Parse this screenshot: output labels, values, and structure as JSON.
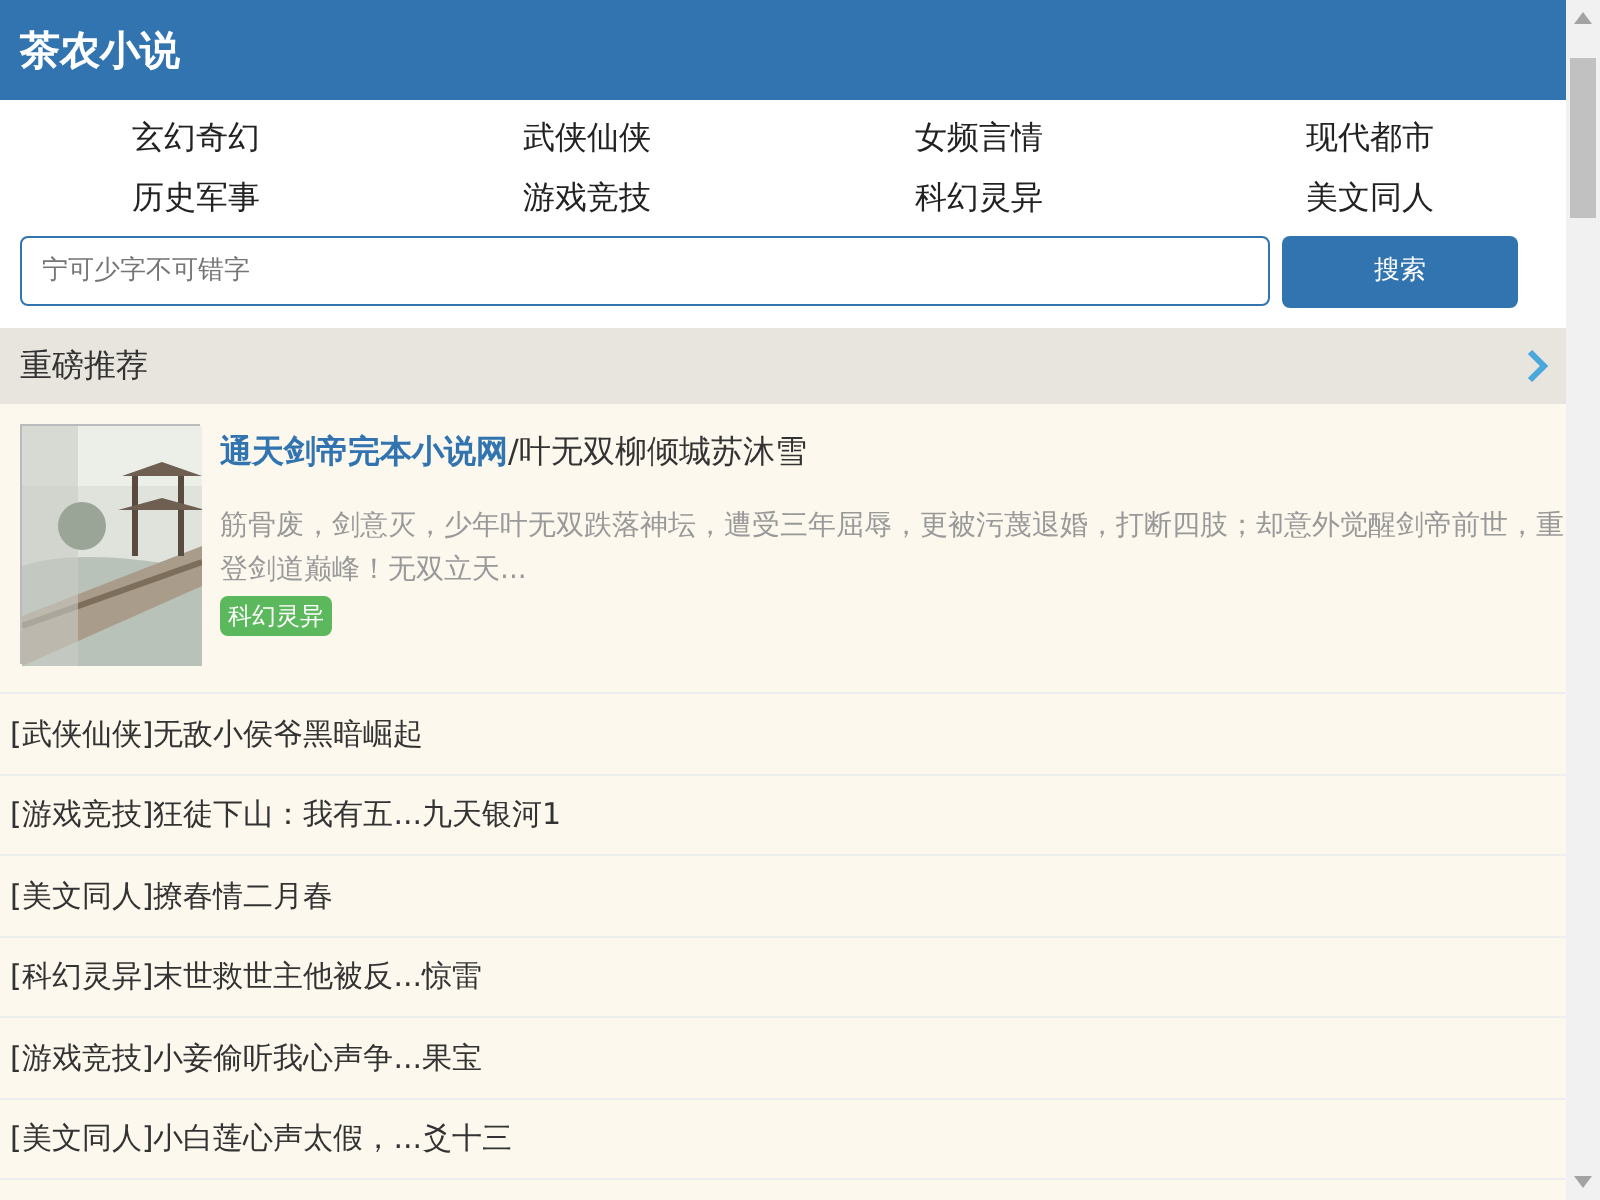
{
  "header": {
    "title": "茶农小说"
  },
  "categories": [
    {
      "label": "玄幻奇幻"
    },
    {
      "label": "武侠仙侠"
    },
    {
      "label": "女频言情"
    },
    {
      "label": "现代都市"
    },
    {
      "label": "历史军事"
    },
    {
      "label": "游戏竞技"
    },
    {
      "label": "科幻灵异"
    },
    {
      "label": "美文同人"
    }
  ],
  "search": {
    "placeholder": "宁可少字不可错字",
    "button": "搜索"
  },
  "section": {
    "title": "重磅推荐"
  },
  "featured": {
    "title": "通天剑帝完本小说网",
    "author": "/叶无双柳倾城苏沐雪",
    "description": "筋骨废，剑意灭，少年叶无双跌落神坛，遭受三年屈辱，更被污蔑退婚，打断四肢；却意外觉醒剑帝前世，重登剑道巅峰！无双立天...",
    "tag": "科幻灵异"
  },
  "list": [
    {
      "text": "[武侠仙侠]无敌小侯爷黑暗崛起"
    },
    {
      "text": "[游戏竞技]狂徒下山：我有五...九天银河1"
    },
    {
      "text": "[美文同人]撩春情二月春"
    },
    {
      "text": "[科幻灵异]末世救世主他被反...惊雷"
    },
    {
      "text": "[游戏竞技]小妾偷听我心声争...果宝"
    },
    {
      "text": "[美文同人]小白莲心声太假，...爻十三"
    }
  ]
}
